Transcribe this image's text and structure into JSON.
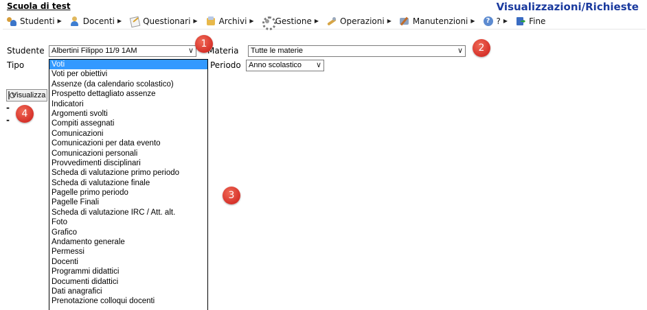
{
  "header": {
    "school_name": "Scuola di test",
    "page_title": "Visualizzazioni/Richieste"
  },
  "menu": [
    {
      "label": "Studenti",
      "icon": "students-icon",
      "arrow": "▶"
    },
    {
      "label": "Docenti",
      "icon": "teachers-icon",
      "arrow": "▶"
    },
    {
      "label": "Questionari",
      "icon": "questionnaire-icon",
      "arrow": "▶"
    },
    {
      "label": "Archivi",
      "icon": "archive-icon",
      "arrow": "▶"
    },
    {
      "label": "Gestione",
      "icon": "gear-icon",
      "arrow": "▶"
    },
    {
      "label": "Operazioni",
      "icon": "operations-icon",
      "arrow": "▶"
    },
    {
      "label": "Manutenzioni",
      "icon": "maintenance-icon",
      "arrow": "▶"
    },
    {
      "label": "?",
      "icon": "help-icon",
      "arrow": "▶"
    },
    {
      "label": "Fine",
      "icon": "exit-icon",
      "arrow": ""
    }
  ],
  "form": {
    "studente_label": "Studente",
    "studente_value": "Albertini Filippo 11/9 1AM",
    "materia_label": "Materia",
    "materia_value": "Tutte le materie",
    "tipo_label": "Tipo",
    "periodo_label": "Periodo",
    "periodo_value": "Anno scolastico",
    "chevron": "∨",
    "visualizza_label": "Visualizza",
    "dash_1": "-",
    "dash_2": "-"
  },
  "badges": {
    "b1": "1",
    "b2": "2",
    "b3": "3",
    "b4": "4"
  },
  "tipo_options": [
    "Voti",
    "Voti per obiettivi",
    "Assenze (da calendario scolastico)",
    "Prospetto dettagliato assenze",
    "Indicatori",
    "Argomenti svolti",
    "Compiti assegnati",
    "Comunicazioni",
    "Comunicazioni per data evento",
    "Comunicazioni personali",
    "Provvedimenti disciplinari",
    "Scheda di valutazione primo periodo",
    "Scheda di valutazione finale",
    "Pagelle primo periodo",
    "Pagelle Finali",
    "Scheda di valutazione IRC / Att. alt.",
    "Foto",
    "Grafico",
    "Andamento generale",
    "Permessi",
    "Docenti",
    "Programmi didattici",
    "Documenti didattici",
    "Dati anagrafici",
    "Prenotazione colloqui docenti"
  ],
  "tipo_selected_index": 0,
  "colors": {
    "title": "#1a3a9e",
    "selection": "#3399ff",
    "badge": "#d6322a"
  }
}
